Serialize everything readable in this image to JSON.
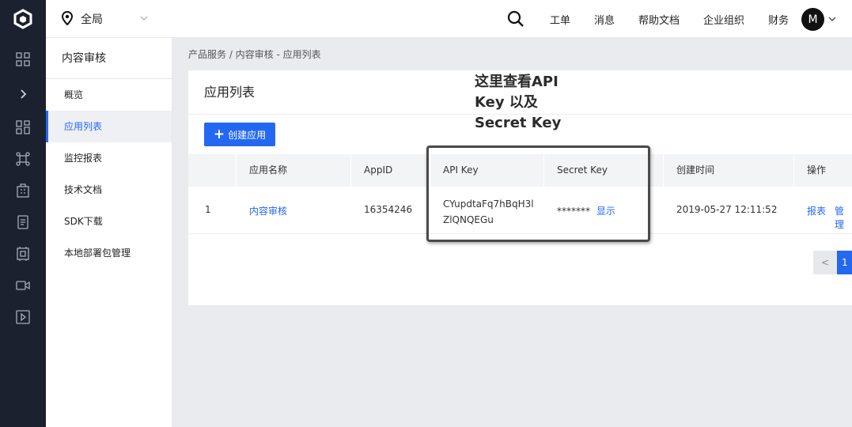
{
  "topbar": {
    "region": "全局",
    "nav": [
      "工单",
      "消息",
      "帮助文档",
      "企业组织",
      "财务"
    ],
    "avatar_letter": "M"
  },
  "sidebar": {
    "title": "内容审核",
    "items": [
      {
        "label": "概览",
        "active": false
      },
      {
        "label": "应用列表",
        "active": true
      },
      {
        "label": "监控报表",
        "active": false
      },
      {
        "label": "技术文档",
        "active": false
      },
      {
        "label": "SDK下载",
        "active": false
      },
      {
        "label": "本地部署包管理",
        "active": false
      }
    ]
  },
  "breadcrumb": "产品服务  /  内容审核 - 应用列表",
  "main": {
    "title": "应用列表",
    "create_button": "创建应用",
    "columns": [
      "应用名称",
      "AppID",
      "API Key",
      "Secret Key",
      "创建时间",
      "操作"
    ],
    "row": {
      "index": "1",
      "name": "内容审核",
      "appid": "16354246",
      "api_key_line1": "CYupdtaFq7hBqH3l",
      "api_key_line2": "ZlQNQEGu",
      "secret_masked": "*******",
      "secret_show": "显示",
      "created": "2019-05-27 12:11:52",
      "action_report": "报表",
      "action_manage": "管理"
    },
    "pager": {
      "prev": "<",
      "page": "1"
    }
  },
  "annotation": {
    "line1": "这里查看API",
    "line2": "Key 以及",
    "line3": "Secret Key"
  },
  "colors": {
    "accent": "#2468f2",
    "rail": "#1c2130"
  }
}
